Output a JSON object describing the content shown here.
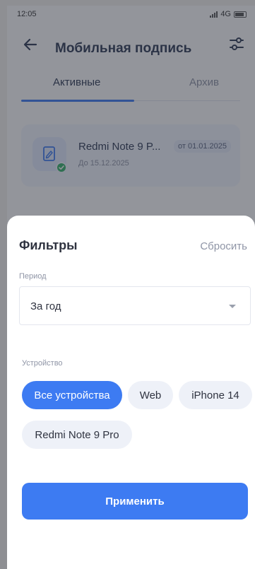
{
  "status_bar": {
    "time": "12:05",
    "network": "4G"
  },
  "app_bar": {
    "title": "Мобильная подпись"
  },
  "tabs": [
    {
      "label": "Активные",
      "active": true
    },
    {
      "label": "Архив",
      "active": false
    }
  ],
  "device_card": {
    "name": "Redmi Note 9 P...",
    "valid_until": "До 15.12.2025",
    "date_badge": "от 01.01.2025",
    "status_icon": "check-icon"
  },
  "filters_sheet": {
    "title": "Фильтры",
    "reset_label": "Сбросить",
    "period": {
      "label": "Период",
      "value": "За год"
    },
    "device": {
      "label": "Устройство",
      "chips": [
        {
          "label": "Все устройства",
          "selected": true
        },
        {
          "label": "Web",
          "selected": false
        },
        {
          "label": "iPhone 14",
          "selected": false
        },
        {
          "label": "Redmi Note 9 Pro",
          "selected": false
        }
      ]
    },
    "apply_label": "Применить"
  },
  "colors": {
    "accent": "#3d7bf2",
    "chip_bg": "#eef1f8",
    "success": "#37b36b",
    "overlay": "rgba(40,44,56,0.5)"
  }
}
